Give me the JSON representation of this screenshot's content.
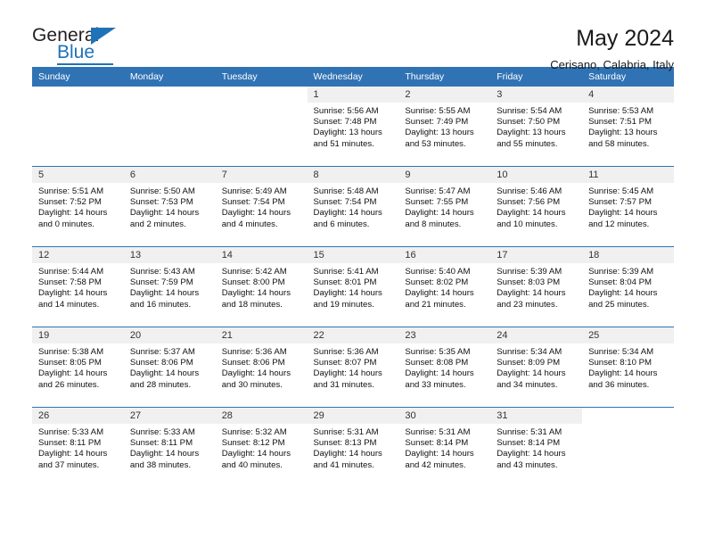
{
  "logo": {
    "word_top": "General",
    "word_bottom": "Blue",
    "triangle_icon": "triangle-icon"
  },
  "header": {
    "title": "May 2024",
    "subtitle": "Cerisano, Calabria, Italy"
  },
  "colors": {
    "header_blue": "#3073b4",
    "logo_blue": "#1f72b8",
    "daynum_band": "#f0f0f0",
    "text": "#111111"
  },
  "weekday_headers": [
    "Sunday",
    "Monday",
    "Tuesday",
    "Wednesday",
    "Thursday",
    "Friday",
    "Saturday"
  ],
  "weeks": [
    [
      {
        "day": "",
        "sunrise": "",
        "sunset": "",
        "daylight_line1": "",
        "daylight_line2": ""
      },
      {
        "day": "",
        "sunrise": "",
        "sunset": "",
        "daylight_line1": "",
        "daylight_line2": ""
      },
      {
        "day": "",
        "sunrise": "",
        "sunset": "",
        "daylight_line1": "",
        "daylight_line2": ""
      },
      {
        "day": "1",
        "sunrise": "Sunrise: 5:56 AM",
        "sunset": "Sunset: 7:48 PM",
        "daylight_line1": "Daylight: 13 hours",
        "daylight_line2": "and 51 minutes."
      },
      {
        "day": "2",
        "sunrise": "Sunrise: 5:55 AM",
        "sunset": "Sunset: 7:49 PM",
        "daylight_line1": "Daylight: 13 hours",
        "daylight_line2": "and 53 minutes."
      },
      {
        "day": "3",
        "sunrise": "Sunrise: 5:54 AM",
        "sunset": "Sunset: 7:50 PM",
        "daylight_line1": "Daylight: 13 hours",
        "daylight_line2": "and 55 minutes."
      },
      {
        "day": "4",
        "sunrise": "Sunrise: 5:53 AM",
        "sunset": "Sunset: 7:51 PM",
        "daylight_line1": "Daylight: 13 hours",
        "daylight_line2": "and 58 minutes."
      }
    ],
    [
      {
        "day": "5",
        "sunrise": "Sunrise: 5:51 AM",
        "sunset": "Sunset: 7:52 PM",
        "daylight_line1": "Daylight: 14 hours",
        "daylight_line2": "and 0 minutes."
      },
      {
        "day": "6",
        "sunrise": "Sunrise: 5:50 AM",
        "sunset": "Sunset: 7:53 PM",
        "daylight_line1": "Daylight: 14 hours",
        "daylight_line2": "and 2 minutes."
      },
      {
        "day": "7",
        "sunrise": "Sunrise: 5:49 AM",
        "sunset": "Sunset: 7:54 PM",
        "daylight_line1": "Daylight: 14 hours",
        "daylight_line2": "and 4 minutes."
      },
      {
        "day": "8",
        "sunrise": "Sunrise: 5:48 AM",
        "sunset": "Sunset: 7:54 PM",
        "daylight_line1": "Daylight: 14 hours",
        "daylight_line2": "and 6 minutes."
      },
      {
        "day": "9",
        "sunrise": "Sunrise: 5:47 AM",
        "sunset": "Sunset: 7:55 PM",
        "daylight_line1": "Daylight: 14 hours",
        "daylight_line2": "and 8 minutes."
      },
      {
        "day": "10",
        "sunrise": "Sunrise: 5:46 AM",
        "sunset": "Sunset: 7:56 PM",
        "daylight_line1": "Daylight: 14 hours",
        "daylight_line2": "and 10 minutes."
      },
      {
        "day": "11",
        "sunrise": "Sunrise: 5:45 AM",
        "sunset": "Sunset: 7:57 PM",
        "daylight_line1": "Daylight: 14 hours",
        "daylight_line2": "and 12 minutes."
      }
    ],
    [
      {
        "day": "12",
        "sunrise": "Sunrise: 5:44 AM",
        "sunset": "Sunset: 7:58 PM",
        "daylight_line1": "Daylight: 14 hours",
        "daylight_line2": "and 14 minutes."
      },
      {
        "day": "13",
        "sunrise": "Sunrise: 5:43 AM",
        "sunset": "Sunset: 7:59 PM",
        "daylight_line1": "Daylight: 14 hours",
        "daylight_line2": "and 16 minutes."
      },
      {
        "day": "14",
        "sunrise": "Sunrise: 5:42 AM",
        "sunset": "Sunset: 8:00 PM",
        "daylight_line1": "Daylight: 14 hours",
        "daylight_line2": "and 18 minutes."
      },
      {
        "day": "15",
        "sunrise": "Sunrise: 5:41 AM",
        "sunset": "Sunset: 8:01 PM",
        "daylight_line1": "Daylight: 14 hours",
        "daylight_line2": "and 19 minutes."
      },
      {
        "day": "16",
        "sunrise": "Sunrise: 5:40 AM",
        "sunset": "Sunset: 8:02 PM",
        "daylight_line1": "Daylight: 14 hours",
        "daylight_line2": "and 21 minutes."
      },
      {
        "day": "17",
        "sunrise": "Sunrise: 5:39 AM",
        "sunset": "Sunset: 8:03 PM",
        "daylight_line1": "Daylight: 14 hours",
        "daylight_line2": "and 23 minutes."
      },
      {
        "day": "18",
        "sunrise": "Sunrise: 5:39 AM",
        "sunset": "Sunset: 8:04 PM",
        "daylight_line1": "Daylight: 14 hours",
        "daylight_line2": "and 25 minutes."
      }
    ],
    [
      {
        "day": "19",
        "sunrise": "Sunrise: 5:38 AM",
        "sunset": "Sunset: 8:05 PM",
        "daylight_line1": "Daylight: 14 hours",
        "daylight_line2": "and 26 minutes."
      },
      {
        "day": "20",
        "sunrise": "Sunrise: 5:37 AM",
        "sunset": "Sunset: 8:06 PM",
        "daylight_line1": "Daylight: 14 hours",
        "daylight_line2": "and 28 minutes."
      },
      {
        "day": "21",
        "sunrise": "Sunrise: 5:36 AM",
        "sunset": "Sunset: 8:06 PM",
        "daylight_line1": "Daylight: 14 hours",
        "daylight_line2": "and 30 minutes."
      },
      {
        "day": "22",
        "sunrise": "Sunrise: 5:36 AM",
        "sunset": "Sunset: 8:07 PM",
        "daylight_line1": "Daylight: 14 hours",
        "daylight_line2": "and 31 minutes."
      },
      {
        "day": "23",
        "sunrise": "Sunrise: 5:35 AM",
        "sunset": "Sunset: 8:08 PM",
        "daylight_line1": "Daylight: 14 hours",
        "daylight_line2": "and 33 minutes."
      },
      {
        "day": "24",
        "sunrise": "Sunrise: 5:34 AM",
        "sunset": "Sunset: 8:09 PM",
        "daylight_line1": "Daylight: 14 hours",
        "daylight_line2": "and 34 minutes."
      },
      {
        "day": "25",
        "sunrise": "Sunrise: 5:34 AM",
        "sunset": "Sunset: 8:10 PM",
        "daylight_line1": "Daylight: 14 hours",
        "daylight_line2": "and 36 minutes."
      }
    ],
    [
      {
        "day": "26",
        "sunrise": "Sunrise: 5:33 AM",
        "sunset": "Sunset: 8:11 PM",
        "daylight_line1": "Daylight: 14 hours",
        "daylight_line2": "and 37 minutes."
      },
      {
        "day": "27",
        "sunrise": "Sunrise: 5:33 AM",
        "sunset": "Sunset: 8:11 PM",
        "daylight_line1": "Daylight: 14 hours",
        "daylight_line2": "and 38 minutes."
      },
      {
        "day": "28",
        "sunrise": "Sunrise: 5:32 AM",
        "sunset": "Sunset: 8:12 PM",
        "daylight_line1": "Daylight: 14 hours",
        "daylight_line2": "and 40 minutes."
      },
      {
        "day": "29",
        "sunrise": "Sunrise: 5:31 AM",
        "sunset": "Sunset: 8:13 PM",
        "daylight_line1": "Daylight: 14 hours",
        "daylight_line2": "and 41 minutes."
      },
      {
        "day": "30",
        "sunrise": "Sunrise: 5:31 AM",
        "sunset": "Sunset: 8:14 PM",
        "daylight_line1": "Daylight: 14 hours",
        "daylight_line2": "and 42 minutes."
      },
      {
        "day": "31",
        "sunrise": "Sunrise: 5:31 AM",
        "sunset": "Sunset: 8:14 PM",
        "daylight_line1": "Daylight: 14 hours",
        "daylight_line2": "and 43 minutes."
      },
      {
        "day": "",
        "sunrise": "",
        "sunset": "",
        "daylight_line1": "",
        "daylight_line2": ""
      }
    ]
  ]
}
